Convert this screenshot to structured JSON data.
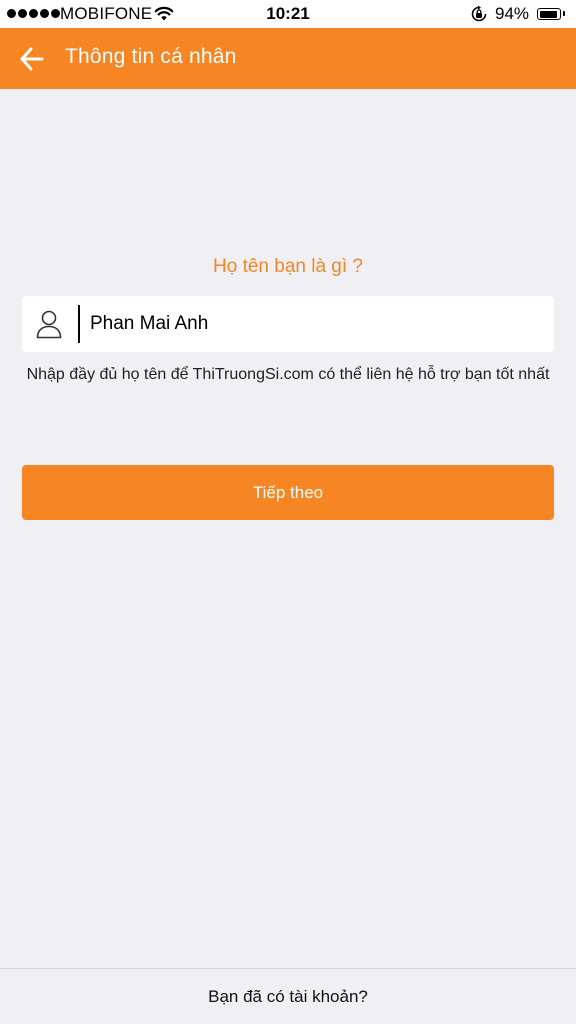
{
  "status_bar": {
    "carrier": "MOBIFONE",
    "time": "10:21",
    "battery_percent": "94%",
    "battery_level": 0.94,
    "signal_bars": 5,
    "icons": [
      "signal-dots-icon",
      "wifi-icon",
      "rotation-lock-icon",
      "battery-icon"
    ]
  },
  "header": {
    "title": "Thông tin cá nhân",
    "back_icon": "arrow-left-icon"
  },
  "form": {
    "question": "Họ tên bạn là gì ?",
    "name_value": "Phan Mai Anh",
    "name_icon": "user-icon",
    "hint": "Nhập đầy đủ họ tên để ThiTruongSi.com có thể liên hệ hỗ trợ bạn tốt nhất",
    "next_label": "Tiếp theo"
  },
  "footer": {
    "login_link": "Bạn đã có tài khoản?"
  },
  "colors": {
    "accent": "#f58623",
    "background": "#efeff4",
    "surface": "#ffffff"
  }
}
